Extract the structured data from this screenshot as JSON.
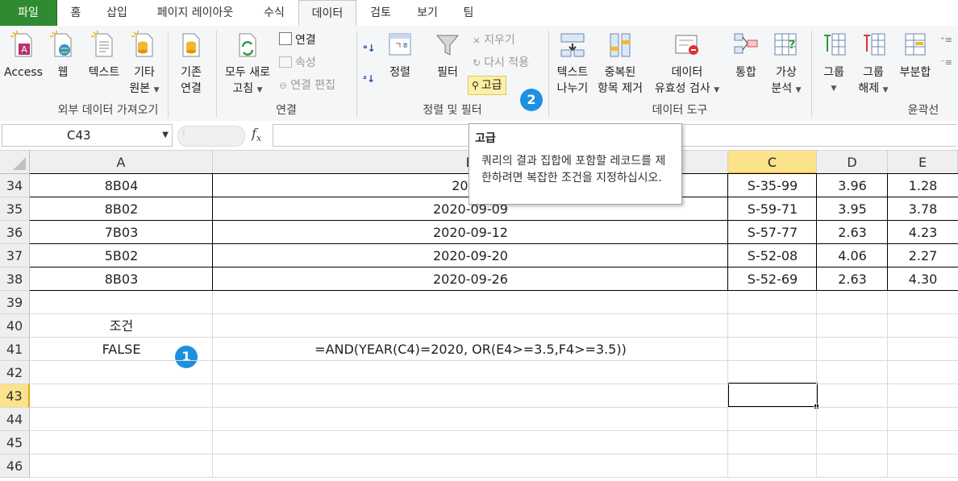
{
  "ribbon": {
    "tabs": [
      "파일",
      "홈",
      "삽입",
      "페이지 레이아웃",
      "수식",
      "데이터",
      "검토",
      "보기",
      "팀"
    ],
    "active_tab": "데이터",
    "groups": {
      "external": {
        "label": "외부 데이터 가져오기",
        "access": "Access",
        "web": "웹",
        "text": "텍스트",
        "other_line1": "기타",
        "other_line2": "원본",
        "existing_line1": "기존",
        "existing_line2": "연결"
      },
      "connections": {
        "label": "연결",
        "refresh_line1": "모두 새로",
        "refresh_line2": "고침",
        "connections": "연결",
        "properties": "속성",
        "edit_links": "연결 편집"
      },
      "sort_filter": {
        "label": "정렬 및 필터",
        "sort": "정렬",
        "filter": "필터",
        "clear": "지우기",
        "reapply": "다시 적용",
        "advanced": "고급"
      },
      "data_tools": {
        "label": "데이터 도구",
        "text_to_cols_line1": "텍스트",
        "text_to_cols_line2": "나누기",
        "remove_dup_line1": "중복된",
        "remove_dup_line2": "항목 제거",
        "validation_line1": "데이터",
        "validation_line2": "유효성 검사",
        "consolidate": "통합",
        "whatif_line1": "가상",
        "whatif_line2": "분석"
      },
      "outline": {
        "label": "윤곽선",
        "group": "그룹",
        "ungroup_line1": "그룹",
        "ungroup_line2": "해제",
        "subtotal": "부분합"
      }
    }
  },
  "formula_bar": {
    "name_box": "C43",
    "fx": "fx",
    "formula": ""
  },
  "tooltip": {
    "title": "고급",
    "body": "쿼리의 결과 집합에 포함할 레코드를 제한하려면 복잡한 조건을 지정하십시오."
  },
  "badges": [
    "1",
    "2"
  ],
  "sheet": {
    "columns": [
      "A",
      "B",
      "C",
      "D",
      "E"
    ],
    "selected_column": "C",
    "selected_row": "43",
    "rows": [
      {
        "num": "34",
        "a": "8B04",
        "b": "2020-",
        "c": "S-35-99",
        "d": "3.96",
        "e": "1.28"
      },
      {
        "num": "35",
        "a": "8B02",
        "b": "2020-09-09",
        "c": "S-59-71",
        "d": "3.95",
        "e": "3.78"
      },
      {
        "num": "36",
        "a": "7B03",
        "b": "2020-09-12",
        "c": "S-57-77",
        "d": "2.63",
        "e": "4.23"
      },
      {
        "num": "37",
        "a": "5B02",
        "b": "2020-09-20",
        "c": "S-52-08",
        "d": "4.06",
        "e": "2.27"
      },
      {
        "num": "38",
        "a": "8B03",
        "b": "2020-09-26",
        "c": "S-52-69",
        "d": "2.63",
        "e": "4.30"
      },
      {
        "num": "39",
        "a": "",
        "b": "",
        "c": "",
        "d": "",
        "e": ""
      },
      {
        "num": "40",
        "a": "조건",
        "b": "",
        "c": "",
        "d": "",
        "e": ""
      },
      {
        "num": "41",
        "a": "FALSE",
        "b": "=AND(YEAR(C4)=2020, OR(E4>=3.5,F4>=3.5))",
        "c": "",
        "d": "",
        "e": ""
      },
      {
        "num": "42",
        "a": "",
        "b": "",
        "c": "",
        "d": "",
        "e": ""
      },
      {
        "num": "43",
        "a": "",
        "b": "",
        "c": "",
        "d": "",
        "e": ""
      },
      {
        "num": "44",
        "a": "",
        "b": "",
        "c": "",
        "d": "",
        "e": ""
      },
      {
        "num": "45",
        "a": "",
        "b": "",
        "c": "",
        "d": "",
        "e": ""
      },
      {
        "num": "46",
        "a": "",
        "b": "",
        "c": "",
        "d": "",
        "e": ""
      }
    ]
  },
  "colors": {
    "file_tab": "#2f8b31",
    "badge": "#1e90e0",
    "selected_header": "#fce28a",
    "advanced_button_highlight": "#fcf0a4"
  }
}
